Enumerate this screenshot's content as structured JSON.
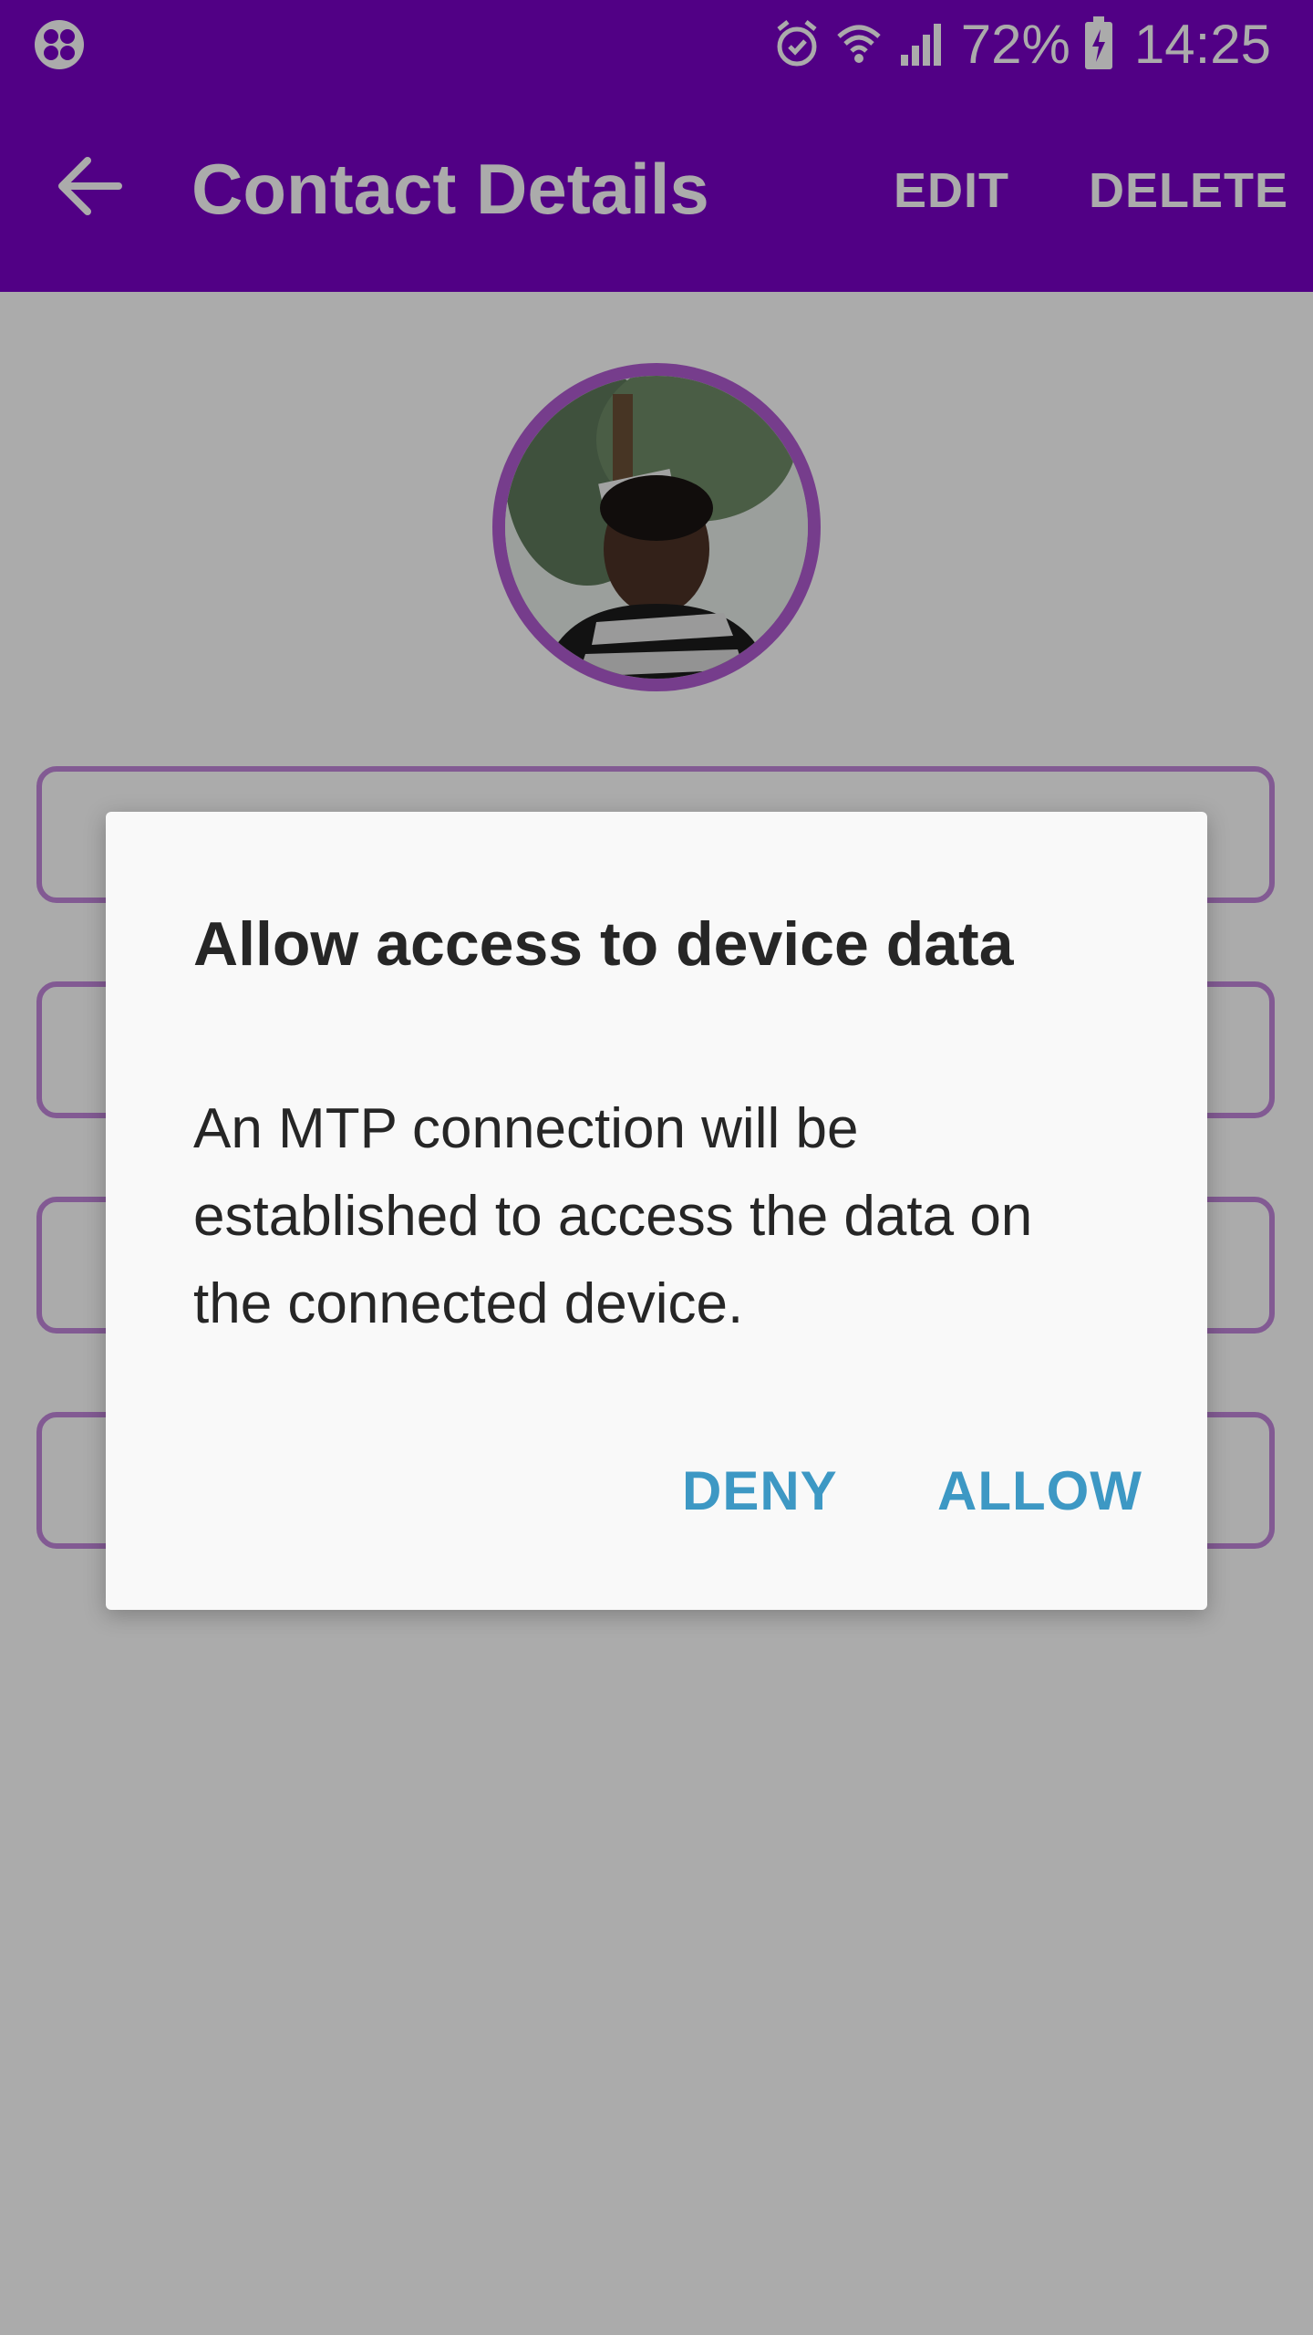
{
  "status_bar": {
    "battery_percent": "72%",
    "time": "14:25",
    "icons": [
      "app-notification-icon",
      "alarm-icon",
      "wifi-icon",
      "signal-icon",
      "battery-charging-icon"
    ]
  },
  "app_bar": {
    "title": "Contact Details",
    "edit_label": "EDIT",
    "delete_label": "DELETE",
    "color": "#7a00c7"
  },
  "dialog": {
    "title": "Allow access to device data",
    "body": "An MTP connection will be established to access the data on the connected device.",
    "deny_label": "DENY",
    "allow_label": "ALLOW",
    "button_color": "#3d98c4"
  }
}
